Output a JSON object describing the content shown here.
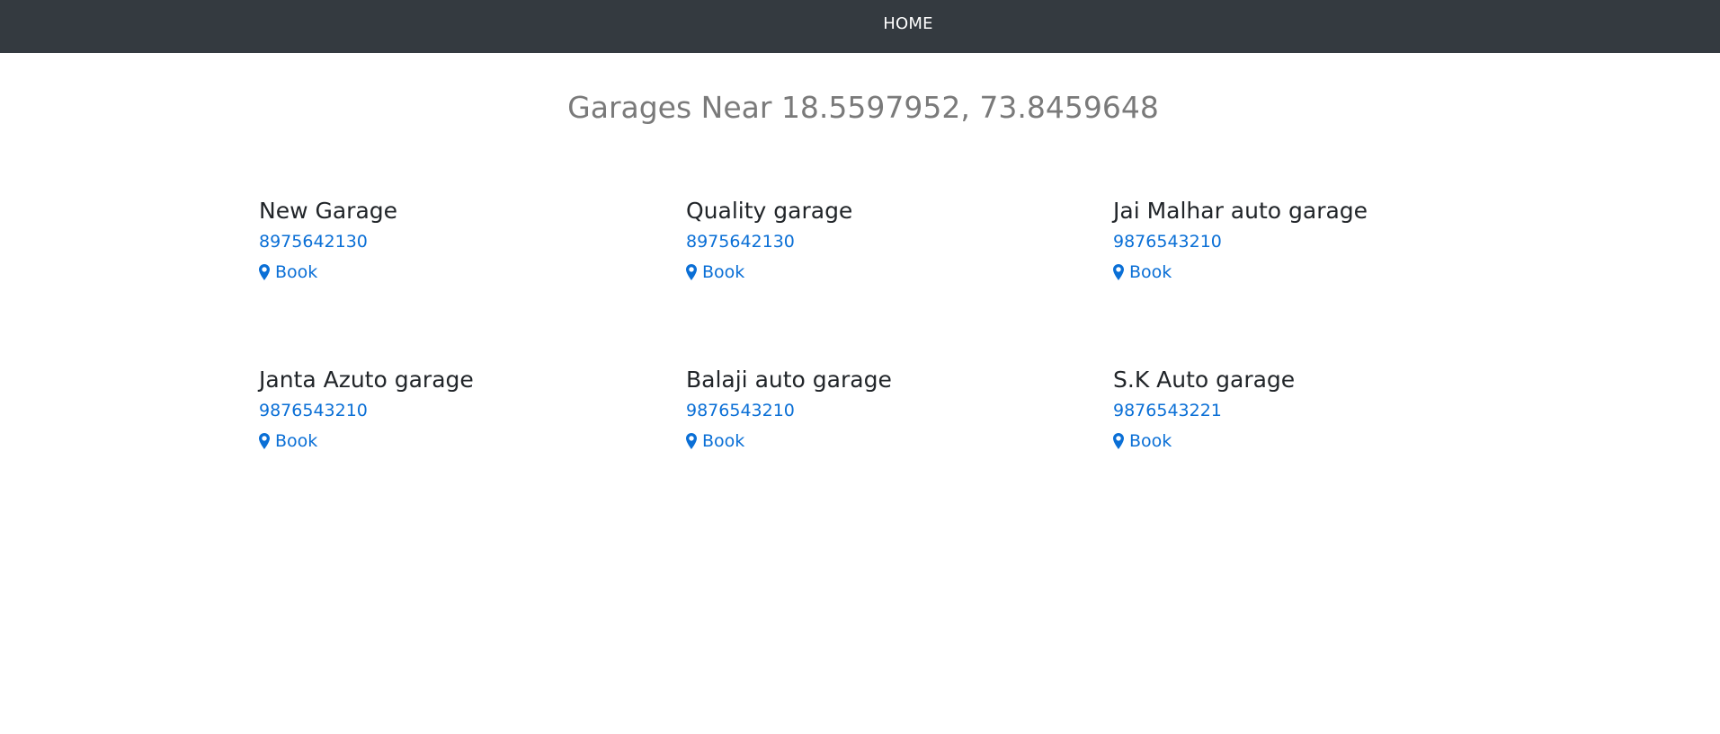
{
  "navbar": {
    "home_label": "HOME"
  },
  "page": {
    "title": "Garages Near 18.5597952, 73.8459648"
  },
  "garages": [
    {
      "name": "New Garage",
      "phone": "8975642130",
      "book_label": "Book"
    },
    {
      "name": "Quality garage",
      "phone": "8975642130",
      "book_label": "Book"
    },
    {
      "name": "Jai Malhar auto garage",
      "phone": "9876543210",
      "book_label": "Book"
    },
    {
      "name": "Janta Azuto garage",
      "phone": "9876543210",
      "book_label": "Book"
    },
    {
      "name": "Balaji auto garage",
      "phone": "9876543210",
      "book_label": "Book"
    },
    {
      "name": "S.K Auto garage",
      "phone": "9876543221",
      "book_label": "Book"
    }
  ],
  "icons": {
    "book": "map-marker-icon"
  },
  "colors": {
    "navbar_bg": "#343a40",
    "link": "#0a6fd6",
    "title": "#7a7a7a",
    "heading": "#212529"
  }
}
